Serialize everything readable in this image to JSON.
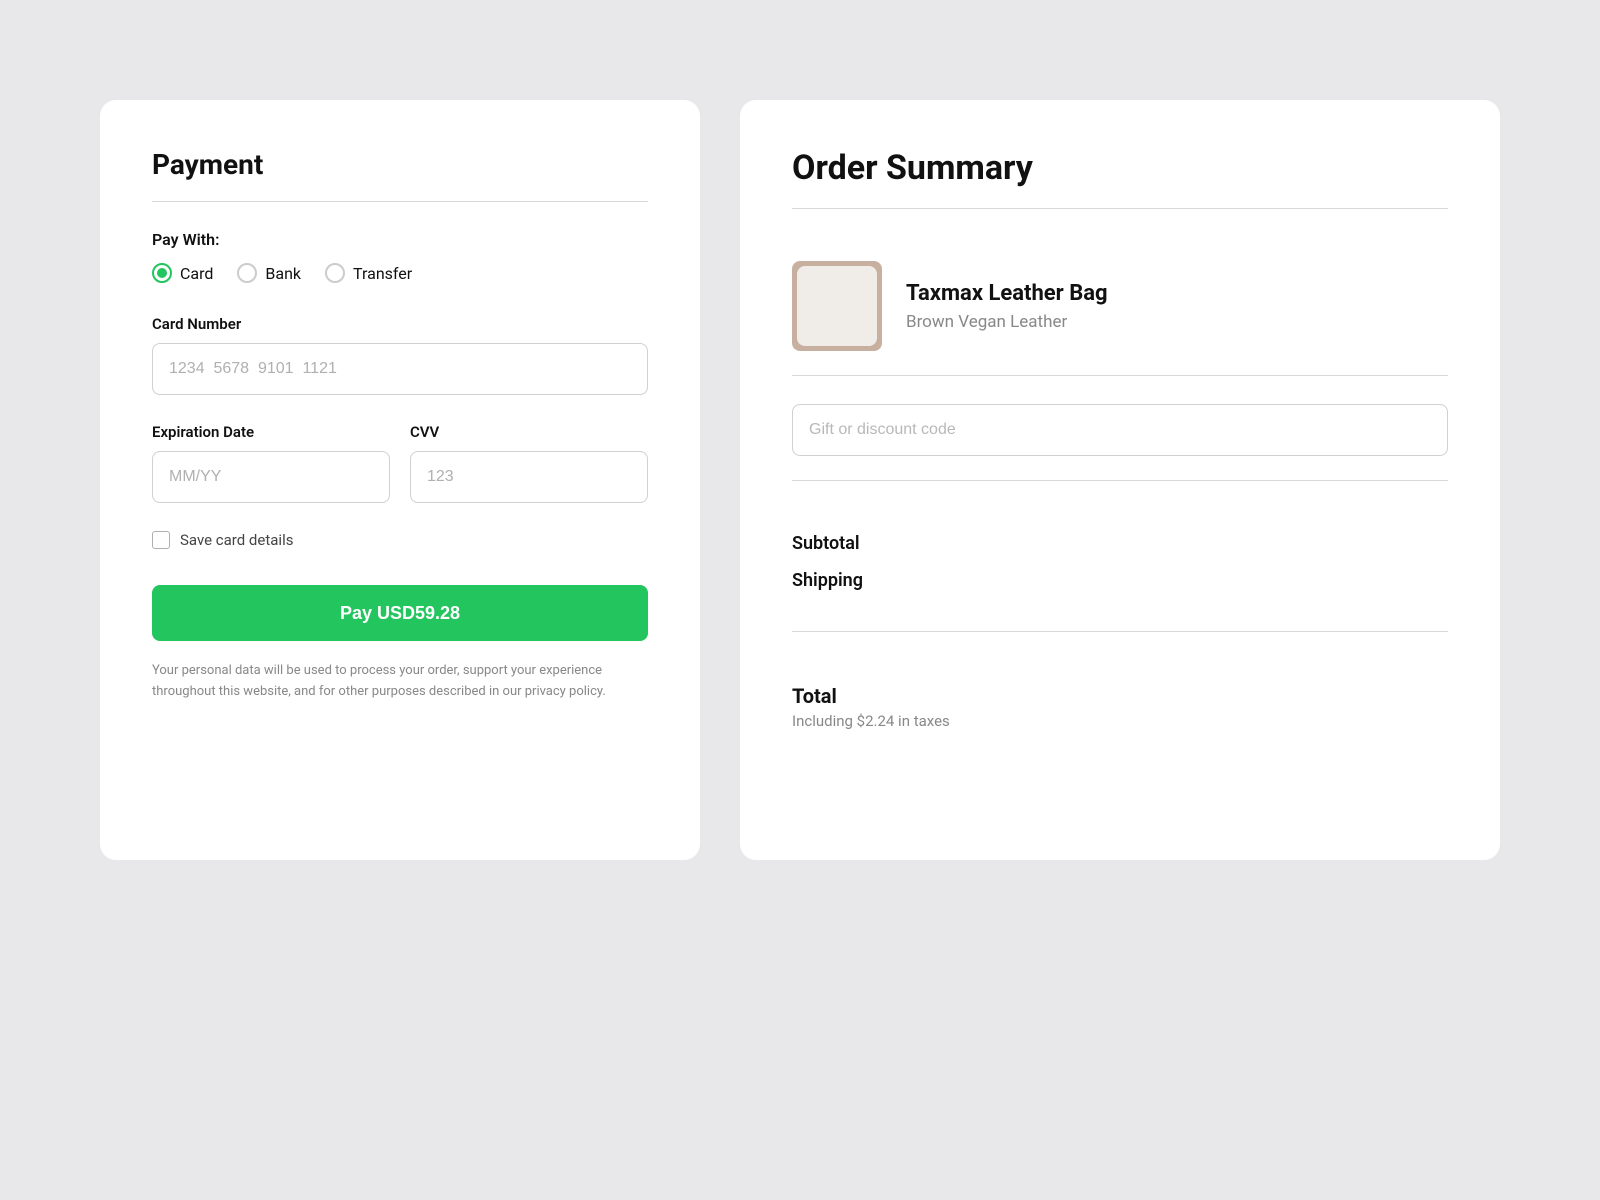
{
  "payment": {
    "title": "Payment",
    "pay_with_label": "Pay With:",
    "payment_methods": [
      {
        "id": "card",
        "label": "Card",
        "checked": true
      },
      {
        "id": "bank",
        "label": "Bank",
        "checked": false
      },
      {
        "id": "transfer",
        "label": "Transfer",
        "checked": false
      }
    ],
    "card_number": {
      "label": "Card Number",
      "placeholder": "1234  5678  9101  1121"
    },
    "expiration_date": {
      "label": "Expiration Date",
      "placeholder": "MM/YY"
    },
    "cvv": {
      "label": "CVV",
      "placeholder": "123"
    },
    "save_card_label": "Save card details",
    "pay_button_label": "Pay USD59.28",
    "privacy_text": "Your personal data will be used to process your order, support your experience throughout this website, and for other purposes described in our privacy policy."
  },
  "order_summary": {
    "title": "Order Summary",
    "product": {
      "name": "Taxmax Leather Bag",
      "variant": "Brown Vegan Leather"
    },
    "discount_placeholder": "Gift or discount code",
    "subtotal_label": "Subtotal",
    "shipping_label": "Shipping",
    "total_label": "Total",
    "total_tax_text": "Including $2.24 in taxes"
  }
}
